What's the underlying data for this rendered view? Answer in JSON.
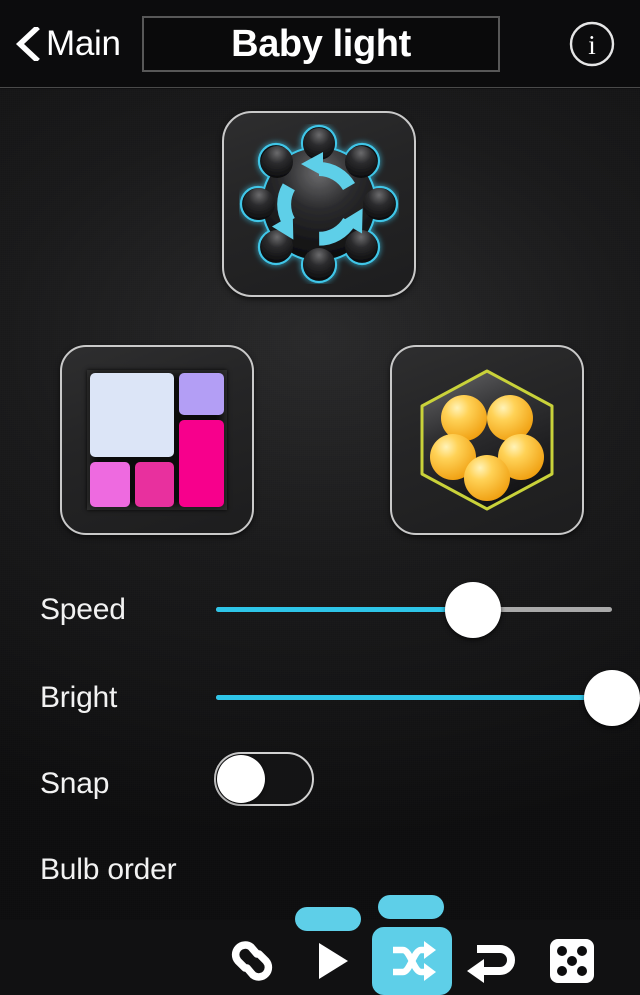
{
  "header": {
    "back_label": "Main",
    "back_icon": "chevron-left-icon",
    "title": "Baby light",
    "info_icon": "info-circle-icon",
    "info_glyph": "i"
  },
  "main": {
    "effect_card": {
      "name": "effect-preset",
      "icon": "gear-cycle-icon",
      "accent": "#5ecfe8"
    },
    "palette_card": {
      "name": "color-palette",
      "icon": "color-swatch-grid-icon",
      "swatches": [
        {
          "name": "swatch-pale-blue",
          "color": "#dce5f7"
        },
        {
          "name": "swatch-light-purple",
          "color": "#b39ef5"
        },
        {
          "name": "swatch-hot-pink",
          "color": "#f7008c"
        },
        {
          "name": "swatch-orchid",
          "color": "#ee6ae0"
        },
        {
          "name": "swatch-deep-pink",
          "color": "#e8309e"
        }
      ]
    },
    "bulbs_card": {
      "name": "bulb-group",
      "icon": "hexagon-five-bulbs-icon",
      "bulb_color": "#ffc432",
      "outline_color": "#c9d23a",
      "bulb_count": 5
    },
    "controls": [
      {
        "label": "Speed",
        "type": "slider",
        "value": 65,
        "min": 0,
        "max": 100,
        "fill_color": "#2ec5e8",
        "track_color": "#a9a9a9"
      },
      {
        "label": "Bright",
        "type": "slider",
        "value": 100,
        "min": 0,
        "max": 100,
        "fill_color": "#2ec5e8",
        "track_color": "#a9a9a9"
      },
      {
        "label": "Snap",
        "type": "toggle",
        "value": "off"
      }
    ],
    "bulb_order": {
      "label": "Bulb order",
      "selected": "shuffle",
      "selected_bg": "#5ecfe8",
      "options": [
        {
          "id": "link",
          "icon": "chain-link-icon"
        },
        {
          "id": "forward",
          "icon": "play-triangle-icon"
        },
        {
          "id": "shuffle",
          "icon": "shuffle-icon"
        },
        {
          "id": "bounce",
          "icon": "u-turn-arrow-icon"
        },
        {
          "id": "random",
          "icon": "dice-five-icon"
        }
      ]
    }
  }
}
